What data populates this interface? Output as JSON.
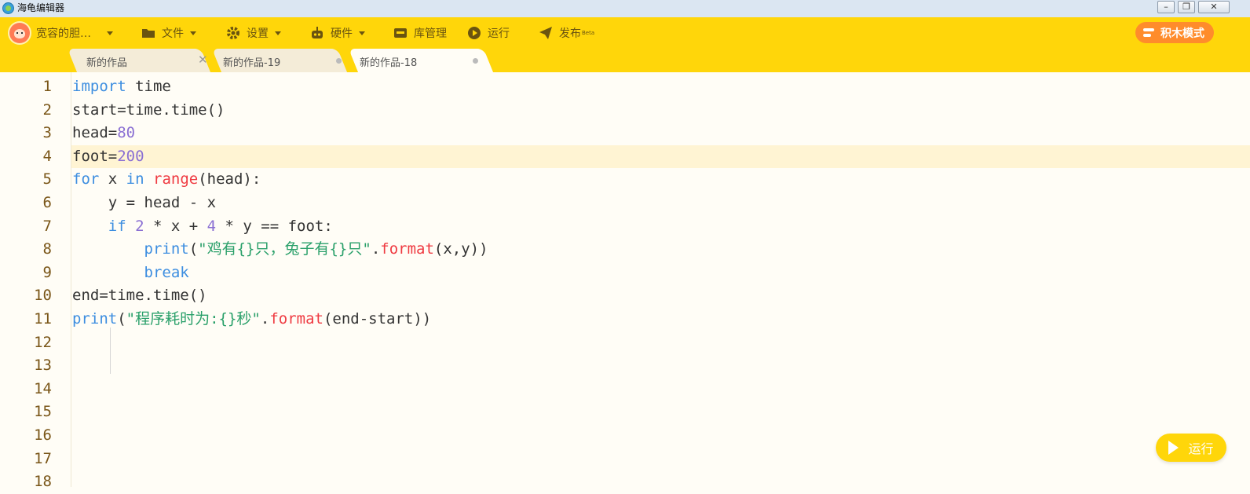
{
  "window": {
    "title": "海龟编辑器"
  },
  "toolbar": {
    "user": "宽容的胆…",
    "file": "文件",
    "settings": "设置",
    "hardware": "硬件",
    "library": "库管理",
    "run": "运行",
    "publish": "发布",
    "publish_badge": "Beta",
    "blocks_mode": "积木模式"
  },
  "tabs": [
    {
      "label": "新的作品",
      "state": "close"
    },
    {
      "label": "新的作品-19",
      "state": "dot"
    },
    {
      "label": "新的作品-18",
      "state": "active"
    }
  ],
  "editor": {
    "highlighted_line": 4,
    "lines": [
      "1",
      "2",
      "3",
      "4",
      "5",
      "6",
      "7",
      "8",
      "9",
      "10",
      "11",
      "12",
      "13",
      "14",
      "15",
      "16",
      "17",
      "18"
    ],
    "tokens": {
      "l1_import": "import",
      "l1_rest": " time",
      "l2": "start=time.time()",
      "l3_a": "head=",
      "l3_num": "80",
      "l4_a": "foot=",
      "l4_num": "200",
      "l5_for": "for",
      "l5_x": " x ",
      "l5_in": "in",
      "l5_sp": " ",
      "l5_range": "range",
      "l5_rest": "(head):",
      "l6": "    y = head - x",
      "l7_ind": "    ",
      "l7_if": "if",
      "l7_sp": " ",
      "l7_2": "2",
      "l7_mid": " * x + ",
      "l7_4": "4",
      "l7_rest": " * y == foot:",
      "l8_ind": "        ",
      "l8_print": "print",
      "l8_p": "(",
      "l8_str": "\"鸡有{}只，兔子有{}只\"",
      "l8_dot": ".",
      "l8_format": "format",
      "l8_rest": "(x,y))",
      "l9_ind": "        ",
      "l9_break": "break",
      "l10": "end=time.time()",
      "l11_print": "print",
      "l11_p": "(",
      "l11_str": "\"程序耗时为:{}秒\"",
      "l11_dot": ".",
      "l11_format": "format",
      "l11_rest": "(end-start))"
    }
  },
  "run_button": {
    "label": "运行"
  },
  "colors": {
    "toolbar_bg": "#ffd60a",
    "blocks_btn_bg": "#ff8c2b",
    "keyword": "#3d8ee0",
    "number": "#8a6fd3",
    "function": "#ef3b42",
    "string": "#2aa06a",
    "line_number": "#7a5618"
  }
}
